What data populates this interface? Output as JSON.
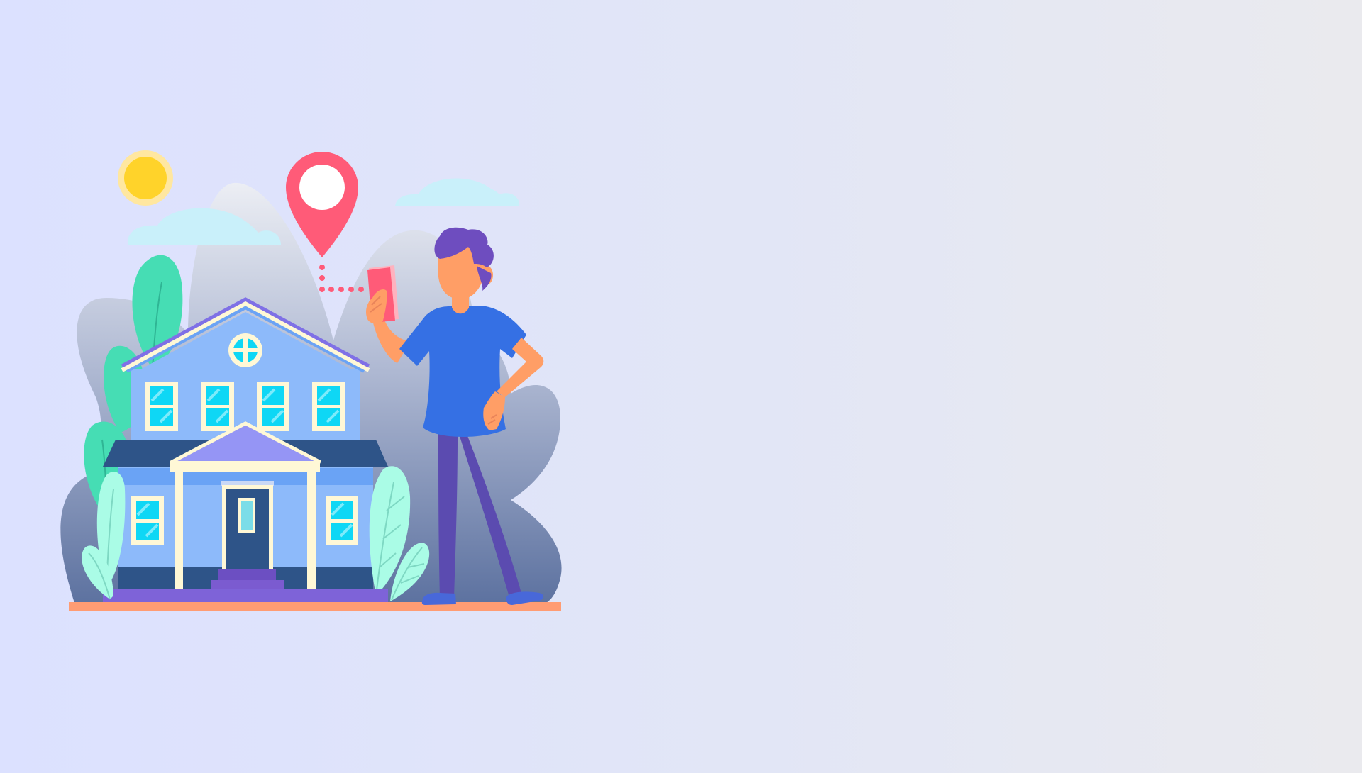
{
  "colors": {
    "background_left": "#DCE1FF",
    "background_right": "#EAEAEE",
    "hill_top": "#E9EBF2",
    "hill_bottom": "#5E73A0",
    "sun_core": "#FFD32A",
    "sun_halo": "#FFE7A0",
    "cloud": "#C9F0FA",
    "pin": "#FF5B78",
    "leaf_dark": "#46DDB4",
    "leaf_light": "#AAFCE6",
    "house_roof_outline": "#7F70E6",
    "house_wall": "#8DBAFA",
    "house_wall_dark": "#6AA3F5",
    "house_trim": "#FFF8D6",
    "house_band": "#2E5488",
    "window_glass": "#0ED7F5",
    "portico_roof": "#9595F5",
    "steps": "#6C4FC2",
    "base": "#7E63D8",
    "ground": "#FF9C73",
    "shirt": "#3570E4",
    "pants": "#5B4BB0",
    "skin": "#FF9E66",
    "hair": "#6E4DBF",
    "shoes": "#4868D9",
    "phone": "#FF5B78"
  },
  "icons": {
    "sun": "sun-icon",
    "location_pin": "location-pin-icon",
    "cloud": "cloud-icon",
    "house": "house-illustration",
    "person": "person-illustration",
    "phone": "smartphone-icon"
  }
}
